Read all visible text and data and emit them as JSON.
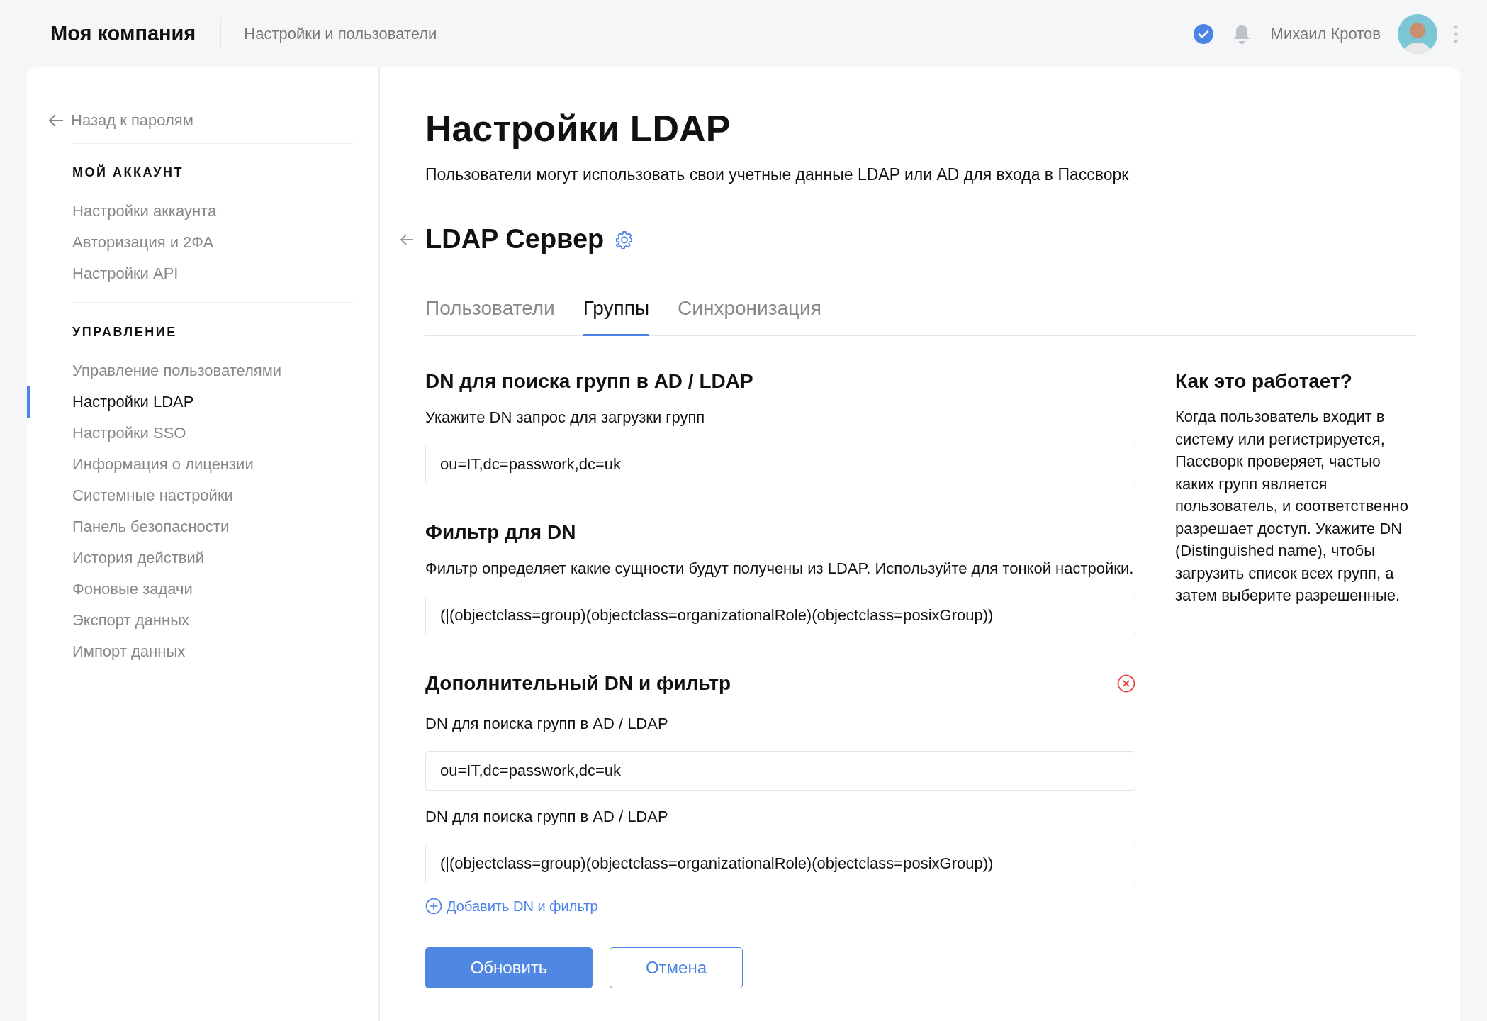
{
  "topbar": {
    "company": "Моя компания",
    "section": "Настройки и пользователи",
    "verified": true,
    "user_name": "Михаил Кротов"
  },
  "sidebar": {
    "back": "Назад к паролям",
    "groups": [
      {
        "heading": "МОЙ АККАУНТ",
        "items": [
          {
            "label": "Настройки аккаунта",
            "selected": false
          },
          {
            "label": "Авторизация и 2ФА",
            "selected": false
          },
          {
            "label": "Настройки API",
            "selected": false
          }
        ]
      },
      {
        "heading": "УПРАВЛЕНИЕ",
        "items": [
          {
            "label": "Управление пользователями",
            "selected": false
          },
          {
            "label": "Настройки LDAP",
            "selected": true
          },
          {
            "label": "Настройки SSO",
            "selected": false
          },
          {
            "label": "Информация о лицензии",
            "selected": false
          },
          {
            "label": "Системные настройки",
            "selected": false
          },
          {
            "label": "Панель безопасности",
            "selected": false
          },
          {
            "label": "История действий",
            "selected": false
          },
          {
            "label": "Фоновые задачи",
            "selected": false
          },
          {
            "label": "Экспорт данных",
            "selected": false
          },
          {
            "label": "Импорт данных",
            "selected": false
          }
        ]
      }
    ]
  },
  "page": {
    "title": "Настройки LDAP",
    "subtitle": "Пользователи могут использовать свои учетные данные LDAP или AD для входа в Пассворк"
  },
  "server": {
    "title": "LDAP Сервер"
  },
  "tabs": [
    {
      "label": "Пользователи",
      "selected": false
    },
    {
      "label": "Группы",
      "selected": true
    },
    {
      "label": "Синхронизация",
      "selected": false
    }
  ],
  "sections": [
    {
      "title": "DN для поиска групп в AD / LDAP",
      "removable": false,
      "description": "Укажите DN запрос для загрузки групп",
      "fields": [
        {
          "value": "ou=IT,dc=passwork,dc=uk"
        }
      ]
    },
    {
      "title": "Фильтр для DN",
      "removable": false,
      "description": "Фильтр определяет какие сущности будут получены из LDAP. Используйте для тонкой настройки.",
      "fields": [
        {
          "value": "(|(objectclass=group)(objectclass=organizationalRole)(objectclass=posixGroup))"
        }
      ]
    },
    {
      "title": "Дополнительный DN и фильтр",
      "removable": true,
      "fields": [
        {
          "label": "DN для поиска групп в AD / LDAP",
          "value": "ou=IT,dc=passwork,dc=uk"
        },
        {
          "label": "DN для поиска групп в AD / LDAP",
          "value": "(|(objectclass=group)(objectclass=organizationalRole)(objectclass=posixGroup))"
        }
      ]
    }
  ],
  "add_link": "Добавить DN и фильтр",
  "buttons": [
    {
      "label": "Обновить",
      "kind": "primary"
    },
    {
      "label": "Отмена",
      "kind": "secondary"
    }
  ],
  "help": {
    "title": "Как это работает?",
    "text": "Когда пользователь входит в систему или регистрируется, Пассворк проверяет, частью каких групп является пользователь, и соответственно разрешает доступ. Укажите DN (Distinguished name), чтобы загрузить список всех групп, а затем выберите разрешенные."
  }
}
